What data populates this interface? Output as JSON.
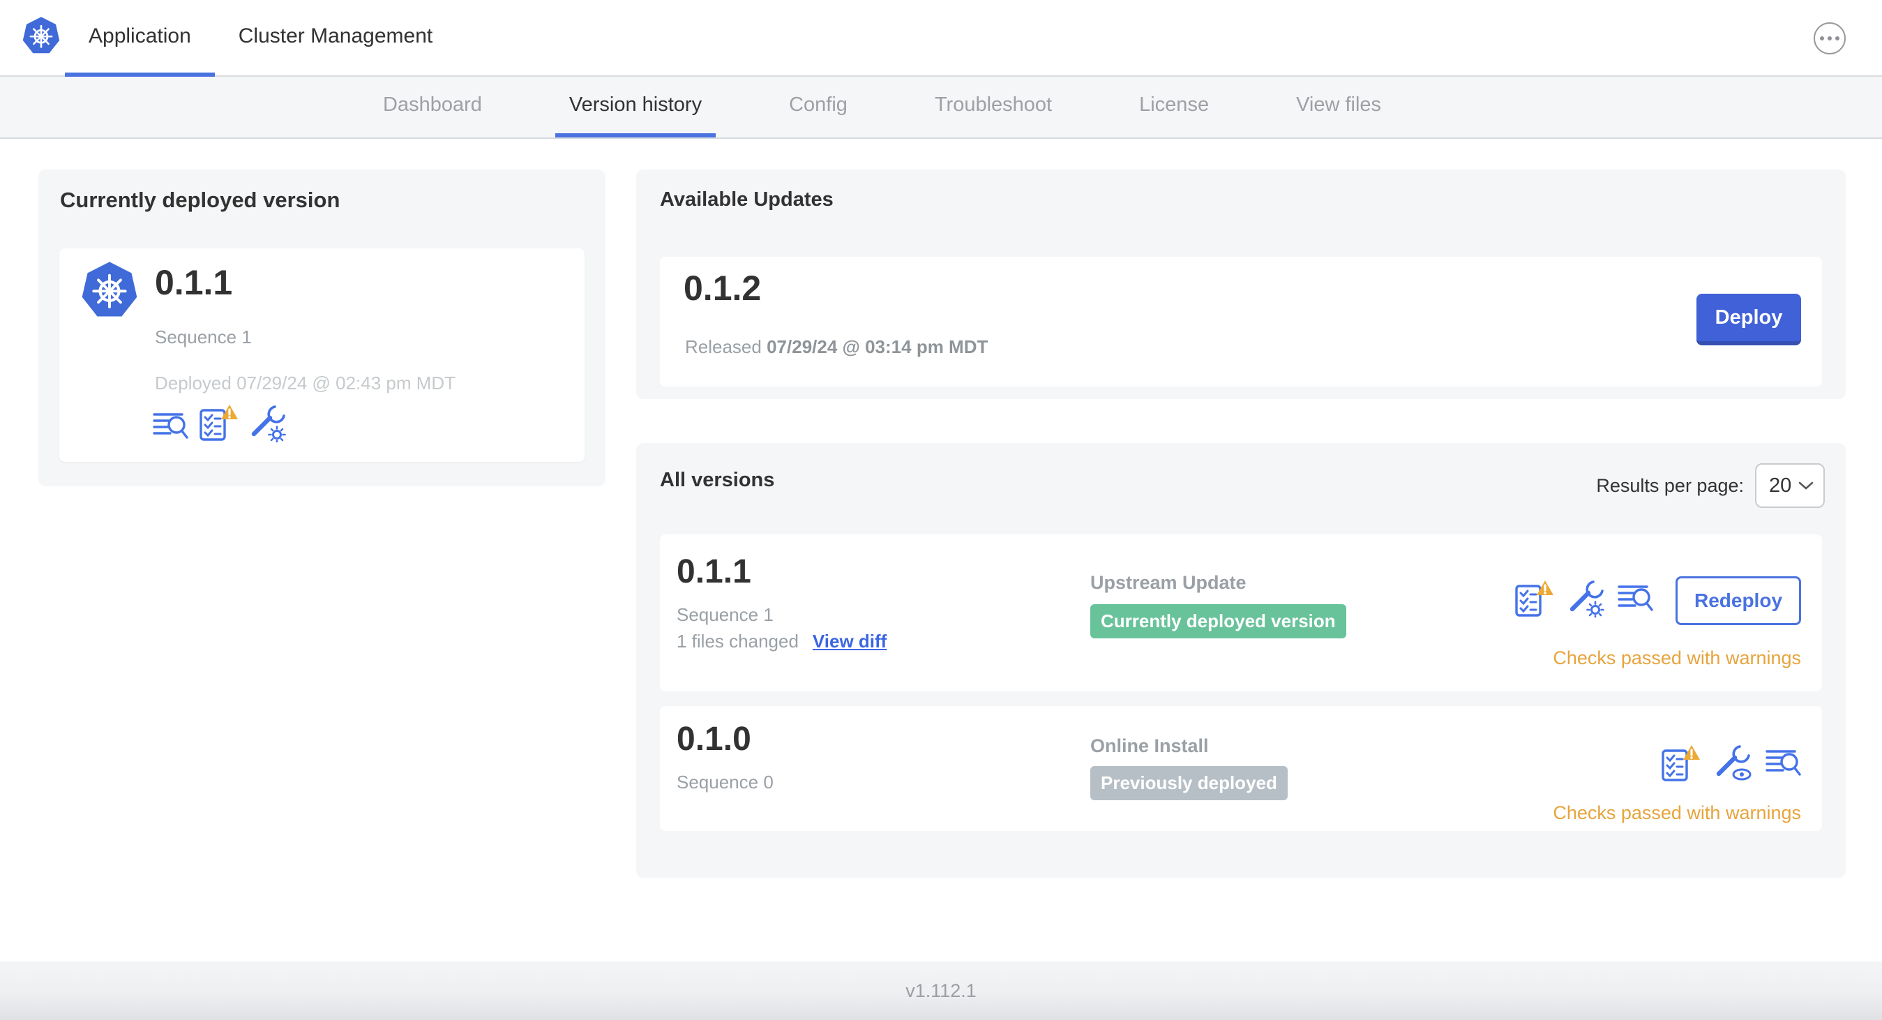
{
  "header": {
    "tabs": [
      {
        "label": "Application",
        "active": true
      },
      {
        "label": "Cluster Management",
        "active": false
      }
    ]
  },
  "nav": {
    "tabs": [
      {
        "label": "Dashboard",
        "active": false
      },
      {
        "label": "Version history",
        "active": true
      },
      {
        "label": "Config",
        "active": false
      },
      {
        "label": "Troubleshoot",
        "active": false
      },
      {
        "label": "License",
        "active": false
      },
      {
        "label": "View files",
        "active": false
      }
    ]
  },
  "deployed_card": {
    "title": "Currently deployed version",
    "version": "0.1.1",
    "sequence": "Sequence 1",
    "deployed_at": "Deployed 07/29/24 @ 02:43 pm MDT"
  },
  "updates": {
    "title": "Available Updates",
    "version": "0.1.2",
    "released_prefix": "Released",
    "released_date": "07/29/24 @ 03:14 pm MDT",
    "deploy_label": "Deploy"
  },
  "all_versions": {
    "title": "All versions",
    "results_label": "Results per page:",
    "results_value": "20",
    "rows": [
      {
        "version": "0.1.1",
        "sequence": "Sequence 1",
        "files_changed": "1 files changed",
        "view_diff_label": "View diff",
        "source": "Upstream Update",
        "badge": "Currently deployed version",
        "action_label": "Redeploy",
        "status": "Checks passed with warnings"
      },
      {
        "version": "0.1.0",
        "sequence": "Sequence 0",
        "source": "Online Install",
        "badge": "Previously deployed",
        "status": "Checks passed with warnings"
      }
    ]
  },
  "footer": {
    "app_version": "v1.112.1"
  },
  "icons": [
    "kubernetes-logo",
    "ellipsis-menu-icon",
    "logs-icon",
    "preflight-checks-warning-icon",
    "warning-triangle-icon",
    "edit-config-icon",
    "view-config-icon",
    "chevron-down-icon"
  ],
  "colors": {
    "accent_blue": "#4a72e0",
    "icon_blue": "#4472e8",
    "deploy_button_blue": "#4161d8",
    "link_blue": "#3c66e1",
    "warning_orange": "#e7a43c",
    "warning_triangle": "#eca935",
    "deployed_badge_green": "#68c29a",
    "previous_badge_gray": "#b6bfc6",
    "card_background_gray": "#f5f6f8",
    "muted_text_gray": "#9aa0a5",
    "faint_text_gray": "#c6cacd"
  }
}
